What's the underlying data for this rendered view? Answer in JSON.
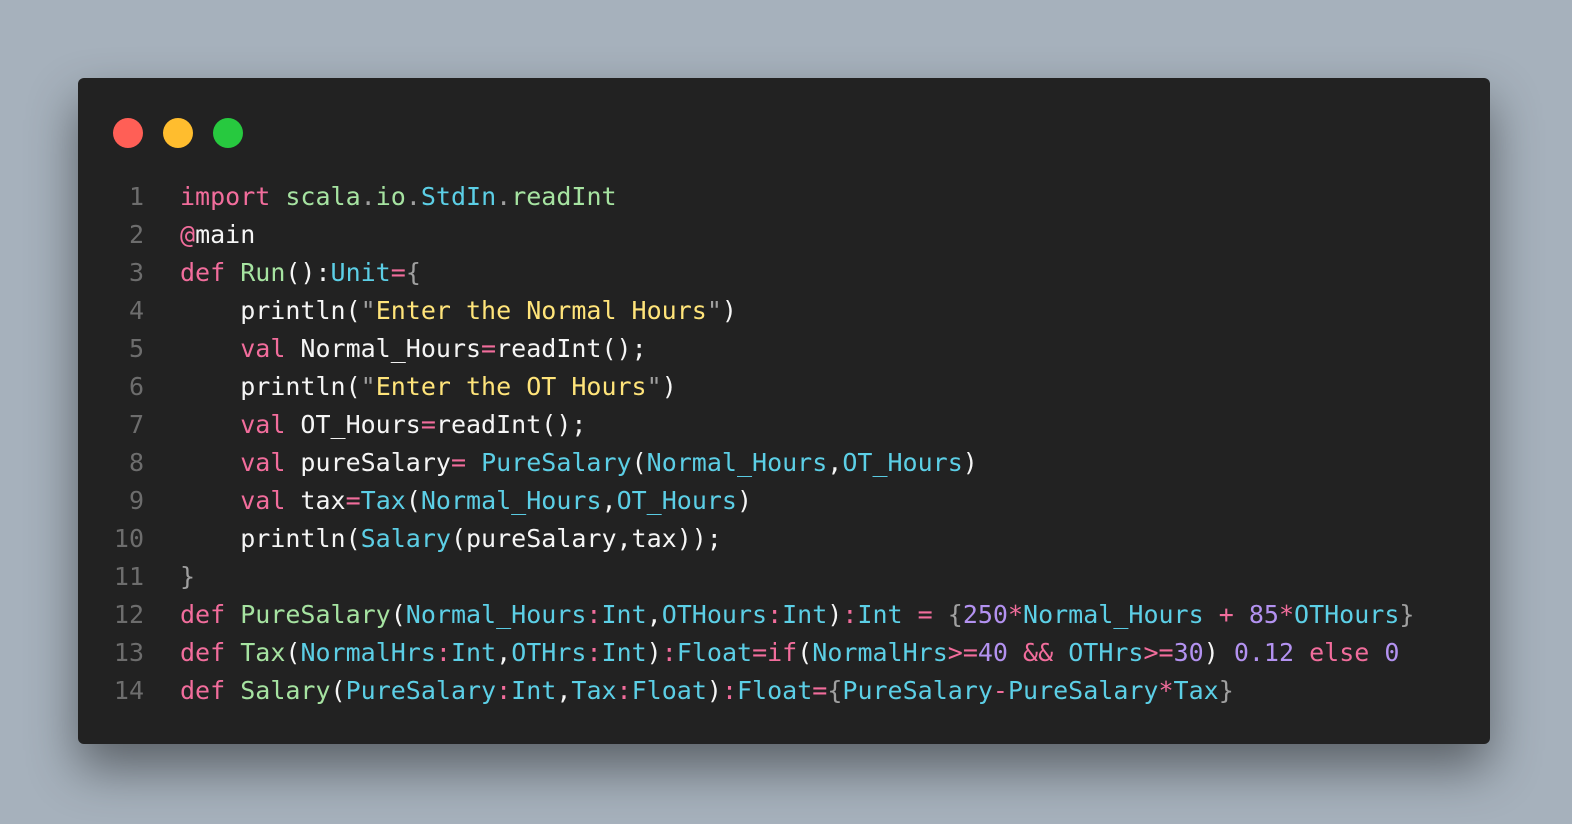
{
  "window": {
    "traffic_lights": {
      "close_color": "#ff5f56",
      "minimize_color": "#ffbd2e",
      "zoom_color": "#27c93f"
    }
  },
  "colors": {
    "keyword": "#f26d9c",
    "name": "#a6e3a1",
    "type": "#5ccfe6",
    "string": "#ffe47a",
    "number": "#b392f0",
    "plain": "#f5f5f5",
    "punct": "#a0a0a0",
    "line_number": "#6d6d6d",
    "background": "#222222"
  },
  "code": {
    "lines": [
      {
        "num": "1",
        "tokens": [
          [
            "import",
            "k"
          ],
          [
            " ",
            "p"
          ],
          [
            "scala",
            "g"
          ],
          [
            ".",
            "d"
          ],
          [
            "io",
            "g"
          ],
          [
            ".",
            "d"
          ],
          [
            "StdIn",
            "t"
          ],
          [
            ".",
            "d"
          ],
          [
            "readInt",
            "g"
          ]
        ]
      },
      {
        "num": "2",
        "tokens": [
          [
            "@",
            "k"
          ],
          [
            "main",
            "p"
          ]
        ]
      },
      {
        "num": "3",
        "tokens": [
          [
            "def",
            "k"
          ],
          [
            " ",
            "p"
          ],
          [
            "Run",
            "g"
          ],
          [
            "():",
            "p"
          ],
          [
            "Unit",
            "t"
          ],
          [
            "=",
            "k"
          ],
          [
            "{",
            "d"
          ]
        ]
      },
      {
        "num": "4",
        "tokens": [
          [
            "    println(",
            "p"
          ],
          [
            "\"",
            "d"
          ],
          [
            "Enter the Normal Hours",
            "s"
          ],
          [
            "\"",
            "d"
          ],
          [
            ")",
            "p"
          ]
        ]
      },
      {
        "num": "5",
        "tokens": [
          [
            "    ",
            "p"
          ],
          [
            "val",
            "k"
          ],
          [
            " Normal_Hours",
            "p"
          ],
          [
            "=",
            "k"
          ],
          [
            "readInt();",
            "p"
          ]
        ]
      },
      {
        "num": "6",
        "tokens": [
          [
            "    println(",
            "p"
          ],
          [
            "\"",
            "d"
          ],
          [
            "Enter the OT Hours",
            "s"
          ],
          [
            "\"",
            "d"
          ],
          [
            ")",
            "p"
          ]
        ]
      },
      {
        "num": "7",
        "tokens": [
          [
            "    ",
            "p"
          ],
          [
            "val",
            "k"
          ],
          [
            " OT_Hours",
            "p"
          ],
          [
            "=",
            "k"
          ],
          [
            "readInt();",
            "p"
          ]
        ]
      },
      {
        "num": "8",
        "tokens": [
          [
            "    ",
            "p"
          ],
          [
            "val",
            "k"
          ],
          [
            " pureSalary",
            "p"
          ],
          [
            "=",
            "k"
          ],
          [
            " ",
            "p"
          ],
          [
            "PureSalary",
            "t"
          ],
          [
            "(",
            "p"
          ],
          [
            "Normal_Hours",
            "t"
          ],
          [
            ",",
            "p"
          ],
          [
            "OT_Hours",
            "t"
          ],
          [
            ")",
            "p"
          ]
        ]
      },
      {
        "num": "9",
        "tokens": [
          [
            "    ",
            "p"
          ],
          [
            "val",
            "k"
          ],
          [
            " tax",
            "p"
          ],
          [
            "=",
            "k"
          ],
          [
            "Tax",
            "t"
          ],
          [
            "(",
            "p"
          ],
          [
            "Normal_Hours",
            "t"
          ],
          [
            ",",
            "p"
          ],
          [
            "OT_Hours",
            "t"
          ],
          [
            ")",
            "p"
          ]
        ]
      },
      {
        "num": "10",
        "tokens": [
          [
            "    println(",
            "p"
          ],
          [
            "Salary",
            "t"
          ],
          [
            "(pureSalary,tax));",
            "p"
          ]
        ]
      },
      {
        "num": "11",
        "tokens": [
          [
            "}",
            "d"
          ]
        ]
      },
      {
        "num": "12",
        "tokens": [
          [
            "def",
            "k"
          ],
          [
            " ",
            "p"
          ],
          [
            "PureSalary",
            "g"
          ],
          [
            "(",
            "p"
          ],
          [
            "Normal_Hours",
            "t"
          ],
          [
            ":",
            "k"
          ],
          [
            "Int",
            "t"
          ],
          [
            ",",
            "p"
          ],
          [
            "OTHours",
            "t"
          ],
          [
            ":",
            "k"
          ],
          [
            "Int",
            "t"
          ],
          [
            ")",
            "p"
          ],
          [
            ":",
            "k"
          ],
          [
            "Int",
            "t"
          ],
          [
            " ",
            "p"
          ],
          [
            "=",
            "k"
          ],
          [
            " ",
            "p"
          ],
          [
            "{",
            "d"
          ],
          [
            "250",
            "n"
          ],
          [
            "*",
            "k"
          ],
          [
            "Normal_Hours",
            "t"
          ],
          [
            " ",
            "p"
          ],
          [
            "+",
            "k"
          ],
          [
            " ",
            "p"
          ],
          [
            "85",
            "n"
          ],
          [
            "*",
            "k"
          ],
          [
            "OTHours",
            "t"
          ],
          [
            "}",
            "d"
          ]
        ]
      },
      {
        "num": "13",
        "tokens": [
          [
            "def",
            "k"
          ],
          [
            " ",
            "p"
          ],
          [
            "Tax",
            "g"
          ],
          [
            "(",
            "p"
          ],
          [
            "NormalHrs",
            "t"
          ],
          [
            ":",
            "k"
          ],
          [
            "Int",
            "t"
          ],
          [
            ",",
            "p"
          ],
          [
            "OTHrs",
            "t"
          ],
          [
            ":",
            "k"
          ],
          [
            "Int",
            "t"
          ],
          [
            ")",
            "p"
          ],
          [
            ":",
            "k"
          ],
          [
            "Float",
            "t"
          ],
          [
            "=",
            "k"
          ],
          [
            "if",
            "k"
          ],
          [
            "(",
            "p"
          ],
          [
            "NormalHrs",
            "t"
          ],
          [
            ">=",
            "k"
          ],
          [
            "40",
            "n"
          ],
          [
            " ",
            "p"
          ],
          [
            "&&",
            "k"
          ],
          [
            " ",
            "p"
          ],
          [
            "OTHrs",
            "t"
          ],
          [
            ">=",
            "k"
          ],
          [
            "30",
            "n"
          ],
          [
            ")",
            "p"
          ],
          [
            " ",
            "p"
          ],
          [
            "0.12",
            "n"
          ],
          [
            " ",
            "p"
          ],
          [
            "else",
            "k"
          ],
          [
            " ",
            "p"
          ],
          [
            "0",
            "n"
          ]
        ]
      },
      {
        "num": "14",
        "tokens": [
          [
            "def",
            "k"
          ],
          [
            " ",
            "p"
          ],
          [
            "Salary",
            "g"
          ],
          [
            "(",
            "p"
          ],
          [
            "PureSalary",
            "t"
          ],
          [
            ":",
            "k"
          ],
          [
            "Int",
            "t"
          ],
          [
            ",",
            "p"
          ],
          [
            "Tax",
            "t"
          ],
          [
            ":",
            "k"
          ],
          [
            "Float",
            "t"
          ],
          [
            ")",
            "p"
          ],
          [
            ":",
            "k"
          ],
          [
            "Float",
            "t"
          ],
          [
            "=",
            "k"
          ],
          [
            "{",
            "d"
          ],
          [
            "PureSalary",
            "t"
          ],
          [
            "-",
            "k"
          ],
          [
            "PureSalary",
            "t"
          ],
          [
            "*",
            "k"
          ],
          [
            "Tax",
            "t"
          ],
          [
            "}",
            "d"
          ]
        ]
      }
    ]
  }
}
